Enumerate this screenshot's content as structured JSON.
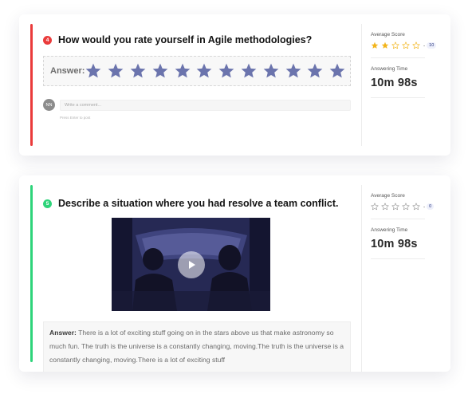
{
  "cards": [
    {
      "number": "4",
      "question": "How would you rate yourself in Agile methodologies?",
      "answer_label": "Answer:",
      "rating_stars": 12,
      "rating_value": 12,
      "avatar_initials": "NN",
      "comment_placeholder": "Write a comment...",
      "comment_hint": "Press Enter to post",
      "side": {
        "avg_label": "Average Score",
        "avg_stars_filled": 2,
        "avg_stars_total": 5,
        "avg_dash": "-",
        "avg_value": "10",
        "time_label": "Answering Time",
        "time_value": "10m 98s"
      }
    },
    {
      "number": "5",
      "question": "Describe a situation where you had resolve a team conflict.",
      "answer_label": "Answer:",
      "answer_text": "There is a lot of exciting stuff going on in the stars above us that make astronomy so much fun. The truth is the universe is a constantly changing, moving.The truth is the universe is a constantly changing, moving.There is a lot of exciting stuff",
      "side": {
        "avg_label": "Average Score",
        "avg_stars_filled": 0,
        "avg_stars_total": 5,
        "avg_dash": "-",
        "avg_value": "0",
        "time_label": "Answering Time",
        "time_value": "10m 98s"
      }
    }
  ],
  "colors": {
    "star_filled_big": "#6b74ad",
    "star_filled_small": "#f3b51c",
    "star_empty_small": "#9a9a9a",
    "accent_red": "#ea3b3b",
    "accent_green": "#2ed47a"
  }
}
